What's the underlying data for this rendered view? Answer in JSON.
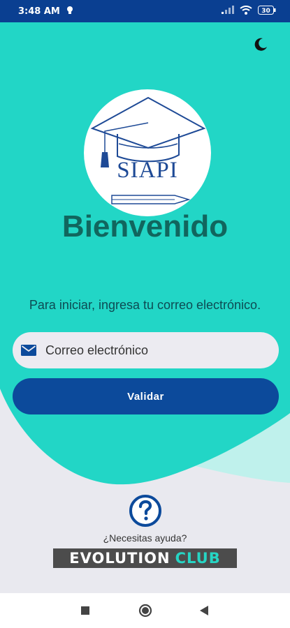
{
  "status_bar": {
    "time": "3:48 AM",
    "battery": "30"
  },
  "logo": {
    "text": "SIAPI"
  },
  "login": {
    "title": "Bienvenido",
    "instruction": "Para iniciar, ingresa tu correo electrónico.",
    "email_placeholder": "Correo electrónico",
    "email_value": "",
    "validate_label": "Validar"
  },
  "help": {
    "label": "¿Necesitas ayuda?"
  },
  "brand": {
    "part1": "EVOLUTION",
    "part2": "CLUB"
  },
  "colors": {
    "primary": "#0c4a9b",
    "teal": "#22d6c6",
    "title": "#11665e",
    "accent": "#26d5c4"
  },
  "icons": {
    "theme_toggle": "moon-icon",
    "email": "mail-icon",
    "help": "question-circle-icon",
    "nav_recents": "square-icon",
    "nav_home": "circle-icon",
    "nav_back": "triangle-back-icon"
  }
}
